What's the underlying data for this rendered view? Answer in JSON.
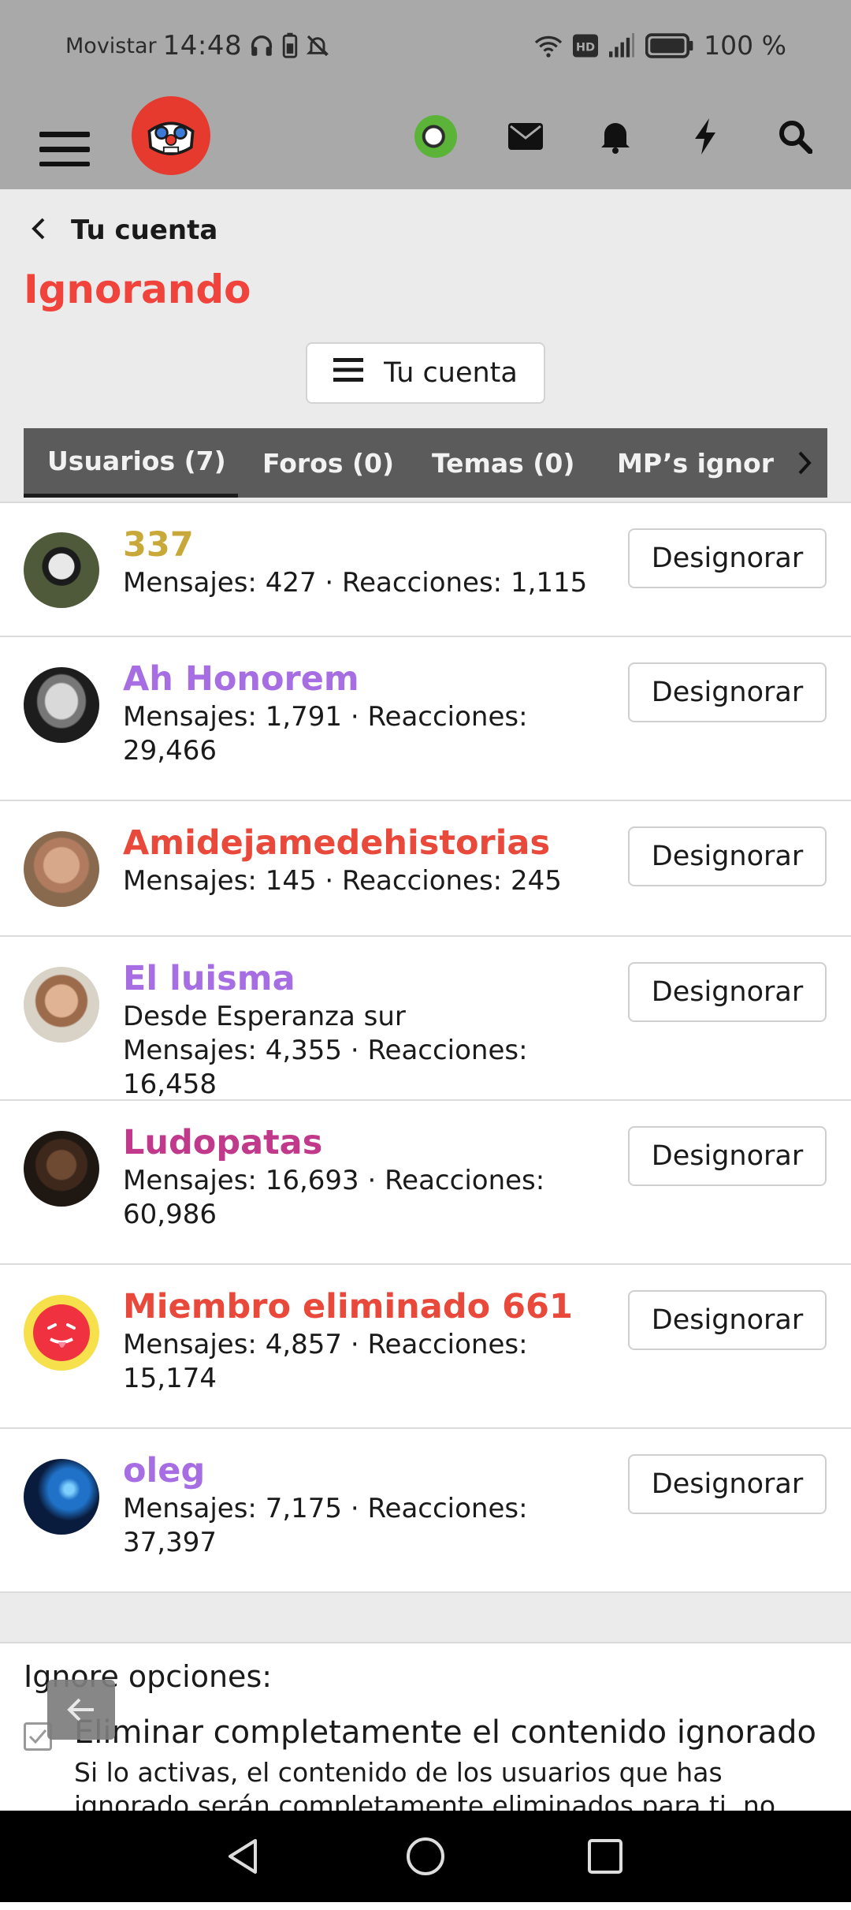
{
  "status_bar": {
    "carrier": "Movistar",
    "time": "14:48",
    "battery_text": "100 %"
  },
  "header": {
    "icons": [
      "menu-icon",
      "site-logo",
      "user-avatar",
      "mail-icon",
      "bell-icon",
      "bolt-icon",
      "search-icon"
    ]
  },
  "breadcrumb": {
    "label": "Tu cuenta"
  },
  "page": {
    "title": "Ignorando"
  },
  "account_menu": {
    "label": "Tu cuenta"
  },
  "tabs": [
    {
      "label": "Usuarios (7)",
      "active": true
    },
    {
      "label": "Foros (0)",
      "active": false
    },
    {
      "label": "Temas (0)",
      "active": false
    },
    {
      "label": "MP’s ignor",
      "active": false
    }
  ],
  "users": [
    {
      "name": "337",
      "name_color": "#c9a83a",
      "meta_line1": "Mensajes: 427 · Reacciones: 1,115",
      "meta_line2": "",
      "button": "Designorar"
    },
    {
      "name": "Ah Honorem",
      "name_color": "#a76ee3",
      "meta_line1": "Mensajes: 1,791 · Reacciones:",
      "meta_line2": "29,466",
      "button": "Designorar"
    },
    {
      "name": "Amidejamedehistorias",
      "name_color": "#e9493b",
      "meta_line1": "Mensajes: 145 · Reacciones: 245",
      "meta_line2": "",
      "button": "Designorar"
    },
    {
      "name": "El luisma",
      "name_color": "#a76ee3",
      "meta_line1": "Desde Esperanza sur",
      "meta_line2": "Mensajes: 4,355 · Reacciones: 16,458",
      "button": "Designorar"
    },
    {
      "name": "Ludopatas",
      "name_color": "#c0398a",
      "meta_line1": "Mensajes: 16,693 · Reacciones:",
      "meta_line2": "60,986",
      "button": "Designorar"
    },
    {
      "name": "Miembro eliminado 661",
      "name_color": "#e9493b",
      "meta_line1": "Mensajes: 4,857 · Reacciones:",
      "meta_line2": "15,174",
      "button": "Designorar"
    },
    {
      "name": "oleg",
      "name_color": "#a76ee3",
      "meta_line1": "Mensajes: 7,175 · Reacciones:",
      "meta_line2": "37,397",
      "button": "Designorar"
    }
  ],
  "options": {
    "heading": "Ignore opciones:",
    "checkbox_label": "Eliminar completamente el contenido ignorado",
    "description": "Si lo activas, el contenido de los usuarios que has ignorado serán completamente eliminados para ti, no"
  },
  "colors": {
    "accent": "#f0433b",
    "header_bg": "#a9a9a9",
    "tab_bg": "#5b5b5b"
  }
}
